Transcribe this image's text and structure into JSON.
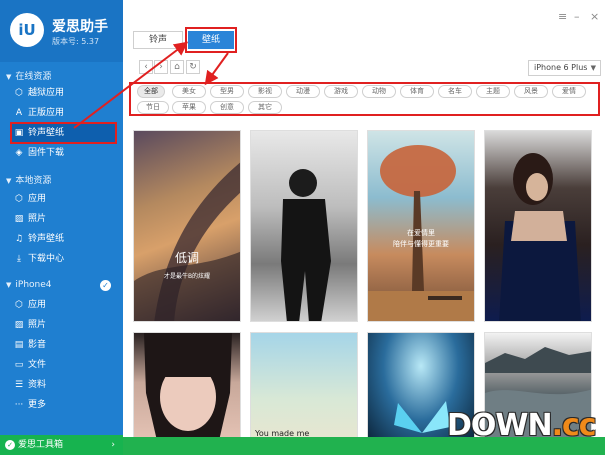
{
  "app": {
    "name": "爱思助手",
    "version": "版本号: 5.37"
  },
  "sidebar": {
    "online_section": "在线资源",
    "online_items": [
      {
        "label": "越狱应用",
        "icon": "jailbreak-icon"
      },
      {
        "label": "正版应用",
        "icon": "app-store-icon"
      },
      {
        "label": "铃声壁纸",
        "icon": "ringtone-wallpaper-icon"
      },
      {
        "label": "固件下载",
        "icon": "firmware-icon"
      }
    ],
    "local_section": "本地资源",
    "local_items": [
      {
        "label": "应用",
        "icon": "apps-icon"
      },
      {
        "label": "照片",
        "icon": "photo-icon"
      },
      {
        "label": "铃声壁纸",
        "icon": "music-icon"
      },
      {
        "label": "下载中心",
        "icon": "download-icon"
      }
    ],
    "device_section": "iPhone4",
    "device_items": [
      {
        "label": "应用",
        "icon": "apps-icon"
      },
      {
        "label": "照片",
        "icon": "photo-icon"
      },
      {
        "label": "影音",
        "icon": "media-icon"
      },
      {
        "label": "文件",
        "icon": "folder-icon"
      },
      {
        "label": "资料",
        "icon": "list-icon"
      },
      {
        "label": "更多",
        "icon": "more-icon"
      }
    ],
    "bottom": "爱思工具箱"
  },
  "tabs": [
    {
      "label": "铃声"
    },
    {
      "label": "壁纸"
    }
  ],
  "device_select": {
    "value": "iPhone 6 Plus"
  },
  "categories_row1": [
    "全部",
    "美女",
    "型男",
    "影视",
    "动漫",
    "游戏",
    "动物",
    "体育",
    "名车",
    "主题",
    "风景",
    "爱情"
  ],
  "categories_row2": [
    "节日",
    "苹果",
    "创意",
    "其它"
  ],
  "thumbnails": {
    "t1": {
      "caption_main": "低调",
      "caption_sub": "才是最牛B的炫耀"
    },
    "t3": {
      "caption_main": "在爱情里",
      "caption_sub": "陪伴与懂得更重要"
    },
    "t6": {
      "caption_main": "You made me"
    }
  },
  "watermark": {
    "main": "DOWN",
    "accent": ".cc"
  },
  "colors": {
    "sidebar": "#1f7fd0",
    "accent": "#2a84d8",
    "highlight": "#e02020",
    "toolbar": "#21b24f"
  }
}
